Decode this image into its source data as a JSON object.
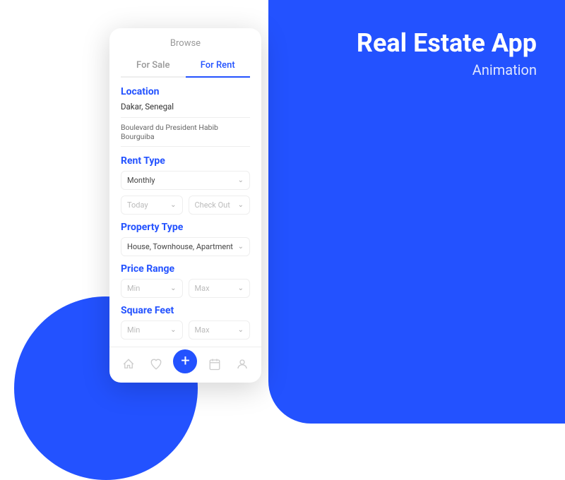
{
  "background": {
    "main_color": "#2352FF"
  },
  "right_panel": {
    "title": "Real Estate App",
    "subtitle": "Animation"
  },
  "phone": {
    "header": "Browse",
    "tabs": [
      {
        "label": "For Sale",
        "active": false
      },
      {
        "label": "For Rent",
        "active": true
      }
    ],
    "location_section": {
      "title": "Location",
      "city": "Dakar, Senegal",
      "street": "Boulevard du President Habib Bourguiba"
    },
    "rent_type_section": {
      "title": "Rent Type",
      "dropdown_label": "Monthly",
      "checkin_label": "Today",
      "checkout_label": "Check Out"
    },
    "property_type_section": {
      "title": "Property Type",
      "dropdown_label": "House, Townhouse, Apartment"
    },
    "price_range_section": {
      "title": "Price Range",
      "min_label": "Min",
      "max_label": "Max"
    },
    "square_feet_section": {
      "title": "Square Feet",
      "min_label": "Min",
      "max_label": "Max"
    },
    "bottom_nav": {
      "home_icon": "⌂",
      "heart_icon": "♡",
      "plus_icon": "+",
      "calendar_icon": "▦",
      "profile_icon": "⚇"
    }
  }
}
